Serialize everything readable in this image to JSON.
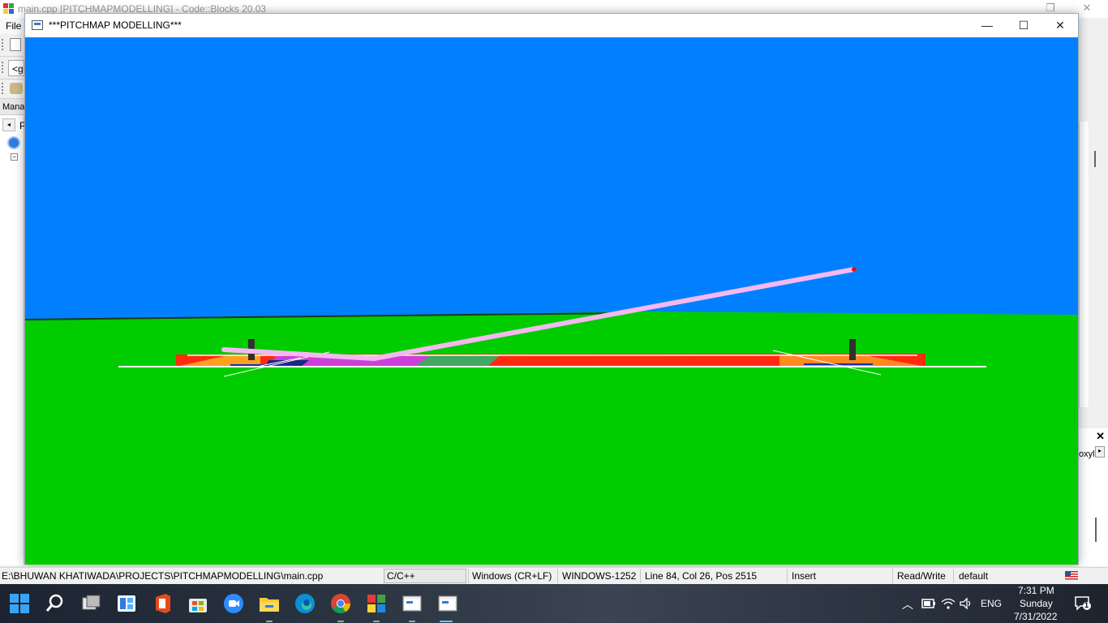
{
  "ide": {
    "title": "main.cpp [PITCHMAPMODELLING] - Code::Blocks 20.03",
    "menu_file": "File",
    "left_strip_1": "<g",
    "left_panel_label": "Mana",
    "left_panel_tab": "P",
    "right_panel_text": "oxyl"
  },
  "gl_window": {
    "title": "***PITCHMAP MODELLING***",
    "sky_color": "#0080ff",
    "ground_color": "#00cc00",
    "ball_trail_color": "#f5b8f0"
  },
  "statusbar": {
    "path": "E:\\BHUWAN KHATIWADA\\PROJECTS\\PITCHMAPMODELLING\\main.cpp",
    "language": "C/C++",
    "line_endings": "Windows (CR+LF)",
    "encoding": "WINDOWS-1252",
    "position": "Line 84, Col 26, Pos 2515",
    "mode": "Insert",
    "access": "Read/Write",
    "profile": "default"
  },
  "taskbar": {
    "apps": [
      "start",
      "search",
      "task-view",
      "widgets",
      "office",
      "store",
      "zoom",
      "file-explorer",
      "edge",
      "chrome",
      "codeblocks",
      "opengl-app",
      "terminal"
    ],
    "tray": {
      "input_lang": "ENG",
      "time": "7:31 PM",
      "day": "Sunday",
      "date": "7/31/2022",
      "notifications": "1"
    }
  }
}
